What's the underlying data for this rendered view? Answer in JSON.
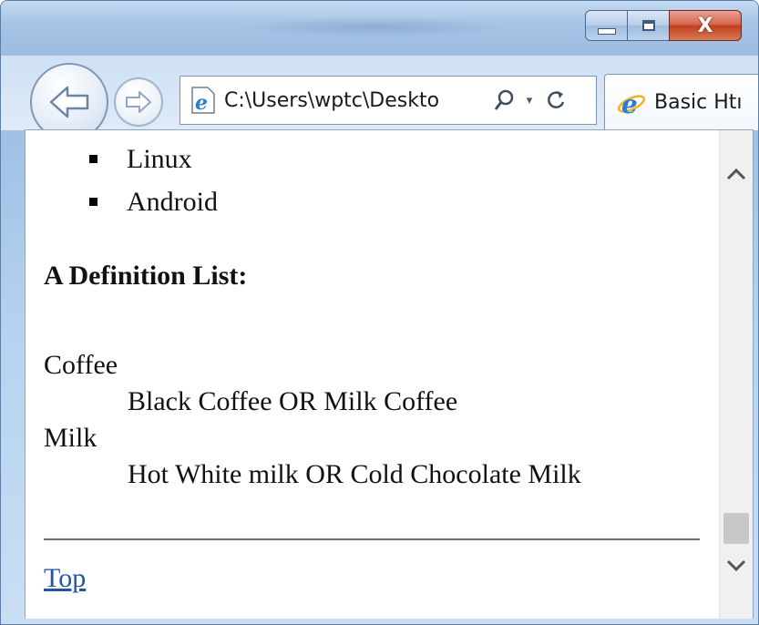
{
  "window": {
    "caption_buttons": {
      "minimize_icon": "minimize-icon",
      "maximize_icon": "maximize-icon",
      "close_glyph": "X"
    }
  },
  "navigation": {
    "back_icon": "arrow-left-icon",
    "forward_icon": "arrow-right-icon",
    "address": "C:\\Users\\wptc\\Deskto",
    "search_icon": "search-icon",
    "dropdown_glyph": "▾",
    "refresh_icon": "refresh-icon"
  },
  "tab": {
    "label": "Basic Htı"
  },
  "page": {
    "bullets": [
      "Linux",
      "Android"
    ],
    "definition_heading": "A Definition List:",
    "definitions": [
      {
        "term": "Coffee",
        "description": "Black Coffee OR Milk Coffee"
      },
      {
        "term": "Milk",
        "description": "Hot White milk OR Cold Chocolate Milk"
      }
    ],
    "top_link": "Top"
  },
  "colors": {
    "link": "#2255aa",
    "frame": "#9cbde2",
    "close_button": "#c2401f"
  }
}
